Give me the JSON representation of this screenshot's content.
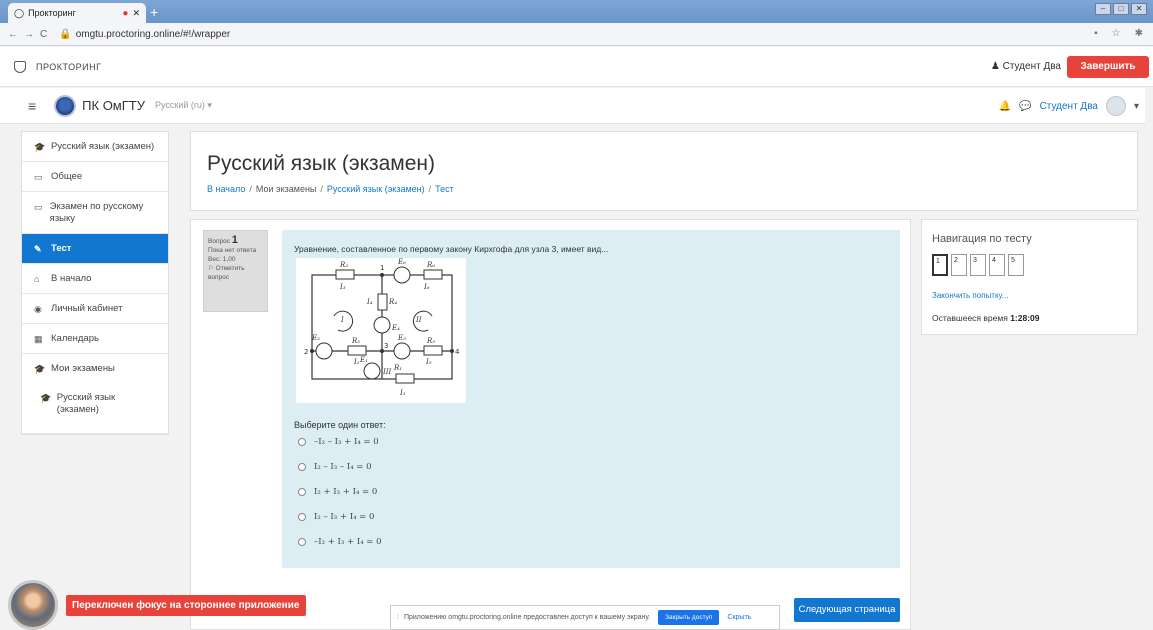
{
  "browser": {
    "tab_title": "Прокторинг",
    "new_tab": "+",
    "url": "omgtu.proctoring.online/#!/wrapper"
  },
  "proctor": {
    "brand": "ПРОКТОРИНГ",
    "user": "Студент Два",
    "finish_label": "Завершить"
  },
  "site": {
    "name": "ПК ОмГТУ",
    "language": "Русский (ru)",
    "user": "Студент Два"
  },
  "sidebar": {
    "items": [
      {
        "label": "Русский язык (экзамен)",
        "icon": "graduation-cap-icon"
      },
      {
        "label": "Общее",
        "icon": "folder-icon"
      },
      {
        "label": "Экзамен по русскому языку",
        "icon": "folder-icon"
      },
      {
        "label": "Тест",
        "icon": "quiz-icon",
        "active": true
      },
      {
        "label": "В начало",
        "icon": "home-icon"
      },
      {
        "label": "Личный кабинет",
        "icon": "dashboard-icon"
      },
      {
        "label": "Календарь",
        "icon": "calendar-icon"
      },
      {
        "label": "Мои экзамены",
        "icon": "graduation-cap-icon"
      },
      {
        "label": "Русский язык (экзамен)",
        "icon": "graduation-cap-icon"
      }
    ]
  },
  "page": {
    "title": "Русский язык (экзамен)",
    "breadcrumb": [
      "В начало",
      "Мои экзамены",
      "Русский язык (экзамен)",
      "Тест"
    ]
  },
  "question": {
    "label": "Вопрос",
    "number": "1",
    "status": "Пока нет ответа",
    "weight": "Вес: 1,00",
    "flag_label": "Отметить вопрос",
    "text": "Уравнение, составленное по первому закону Кирхгофа для узла 3, имеет вид...",
    "prompt": "Выберите один ответ:",
    "options": [
      "–I₂ – I₃ + I₄ = 0",
      "I₂ – I₃ – I₄ = 0",
      "I₂ + I₃ + I₄ = 0",
      "I₂ – I₃ + I₄ = 0",
      "–I₂ + I₃ + I₄ = 0"
    ],
    "circuit_labels": {
      "R3": "R₃",
      "E6": "E₆",
      "R6": "R₆",
      "I3": "I₃",
      "I6": "I₆",
      "I4": "I₄",
      "R4": "R₄",
      "E4": "E₄",
      "loop1": "I",
      "loop2": "II",
      "loop3": "III",
      "E2": "E₂",
      "R2": "R₂",
      "E5": "E₅",
      "R5": "R₅",
      "I2": "I₂",
      "I5": "I₅",
      "E1": "E₁",
      "R1": "R₁",
      "I1": "I₁",
      "n1": "1",
      "n2": "2",
      "n3": "3",
      "n4": "4"
    }
  },
  "next_page": "Следующая страница",
  "quiz_nav": {
    "title": "Навигация по тесту",
    "pages": [
      "1",
      "2",
      "3",
      "4",
      "5"
    ],
    "finish_attempt": "Закончить попытку...",
    "time_label": "Оставшееся время",
    "time_value": "1:28:09"
  },
  "overlay": {
    "focus_warning": "Переключен фокус на стороннее приложение",
    "share_text": "Приложению omgtu.proctoring.online предоставлен доступ к вашему экрану.",
    "stop_share": "Закрыть доступ",
    "hide": "Скрыть"
  }
}
